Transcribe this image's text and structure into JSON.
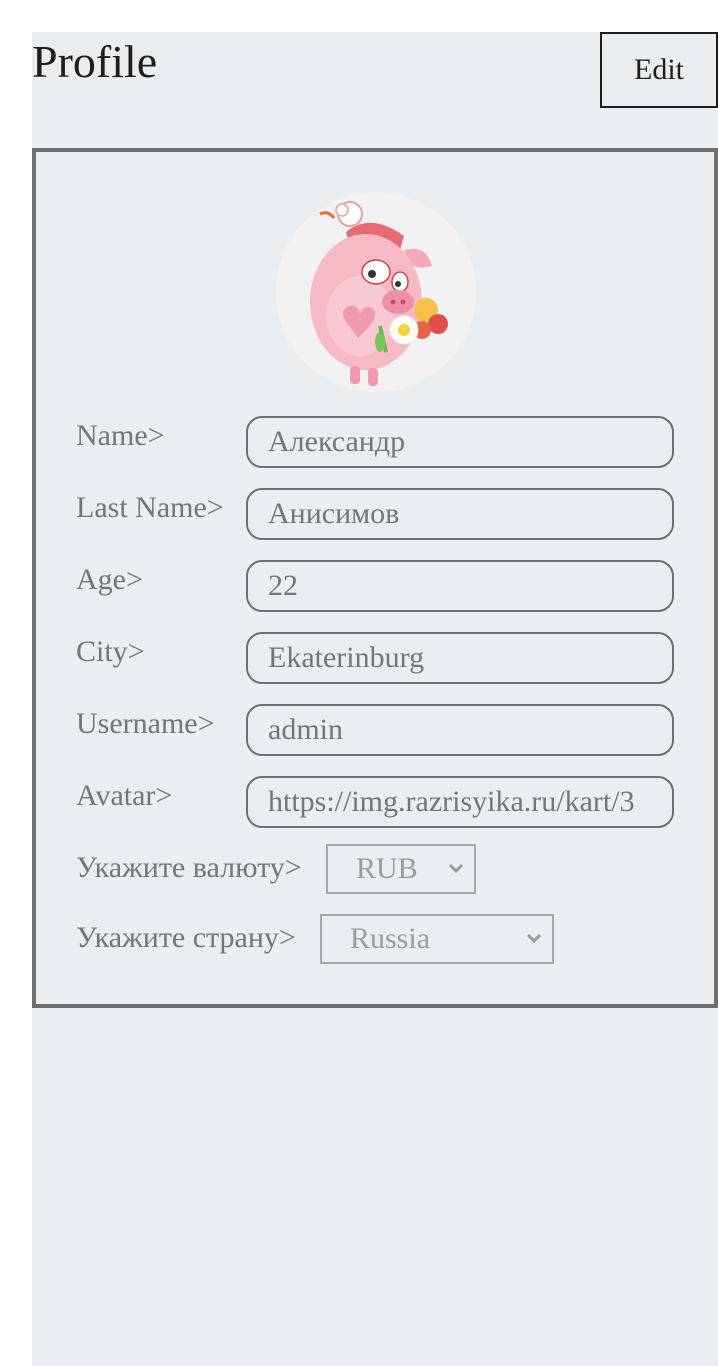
{
  "header": {
    "title": "Profile",
    "edit_label": "Edit"
  },
  "profile": {
    "avatar": {
      "icon": "pig-character-avatar"
    },
    "fields": [
      {
        "label": "Name>",
        "value": "Александр"
      },
      {
        "label": "Last Name>",
        "value": "Анисимов"
      },
      {
        "label": "Age>",
        "value": "22"
      },
      {
        "label": "City>",
        "value": "Ekaterinburg"
      },
      {
        "label": "Username>",
        "value": "admin"
      },
      {
        "label": "Avatar>",
        "value": "https://img.razrisyika.ru/kart/3"
      }
    ],
    "currency": {
      "label": "Укажите валюту>",
      "selected": "RUB"
    },
    "country": {
      "label": "Укажите страну>",
      "selected": "Russia"
    }
  },
  "colors": {
    "page_background": "#eaeef0",
    "border": "#6e6f70",
    "text_muted": "#737577",
    "text_dark": "#1e1e1e"
  }
}
